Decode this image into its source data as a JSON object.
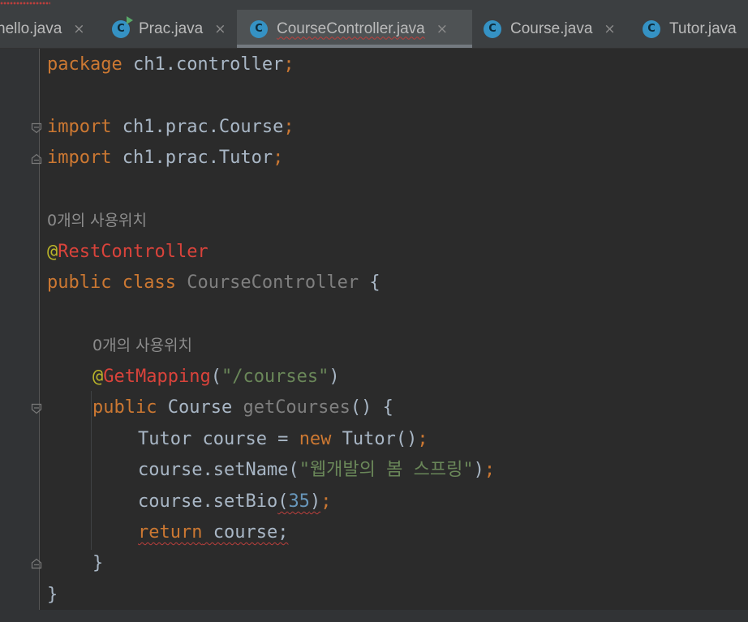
{
  "tabs": [
    {
      "label": "hello.java",
      "close": "×",
      "active": false
    },
    {
      "label": "Prac.java",
      "close": "×",
      "active": false
    },
    {
      "label": "CourseController.java",
      "close": "×",
      "active": true
    },
    {
      "label": "Course.java",
      "close": "×",
      "active": false
    },
    {
      "label": "Tutor.java",
      "close": "",
      "active": false
    }
  ],
  "icon_letter": "C",
  "code": {
    "package_kw": "package",
    "package_name": " ch1.controller",
    "semicolon": ";",
    "import_kw": "import",
    "import1": " ch1.prac.Course",
    "import2": " ch1.prac.Tutor",
    "usage_hint": "0개의 사용위치",
    "at": "@",
    "rest_controller": "RestController",
    "public_kw": "public",
    "class_kw": " class ",
    "class_name": "CourseController",
    "open_brace": " {",
    "method_hint": "0개의 사용위치",
    "get_mapping": "GetMapping",
    "mapping_open": "(",
    "mapping_path": "\"/courses\"",
    "mapping_close": ")",
    "return_type": " Course ",
    "method_name": "getCourses",
    "method_sig_end": "() {",
    "line_tutor": "Tutor course = ",
    "new_kw": "new",
    "line_tutor_end": " Tutor()",
    "set_name_call": "course.setName(",
    "set_name_arg": "\"웹개발의 봄 스프링\"",
    "set_name_end": ")",
    "set_bio_call": "course.setBio",
    "set_bio_arg": "(35)",
    "return_kw": "return",
    "return_val": " course;",
    "close_brace": "}"
  },
  "colors": {
    "background": "#2b2b2b",
    "keyword": "#cc7832",
    "annotation": "#d9433b",
    "string": "#6a8759",
    "number": "#6897bb",
    "text": "#a9b7c6",
    "icon": "#3592c4"
  }
}
